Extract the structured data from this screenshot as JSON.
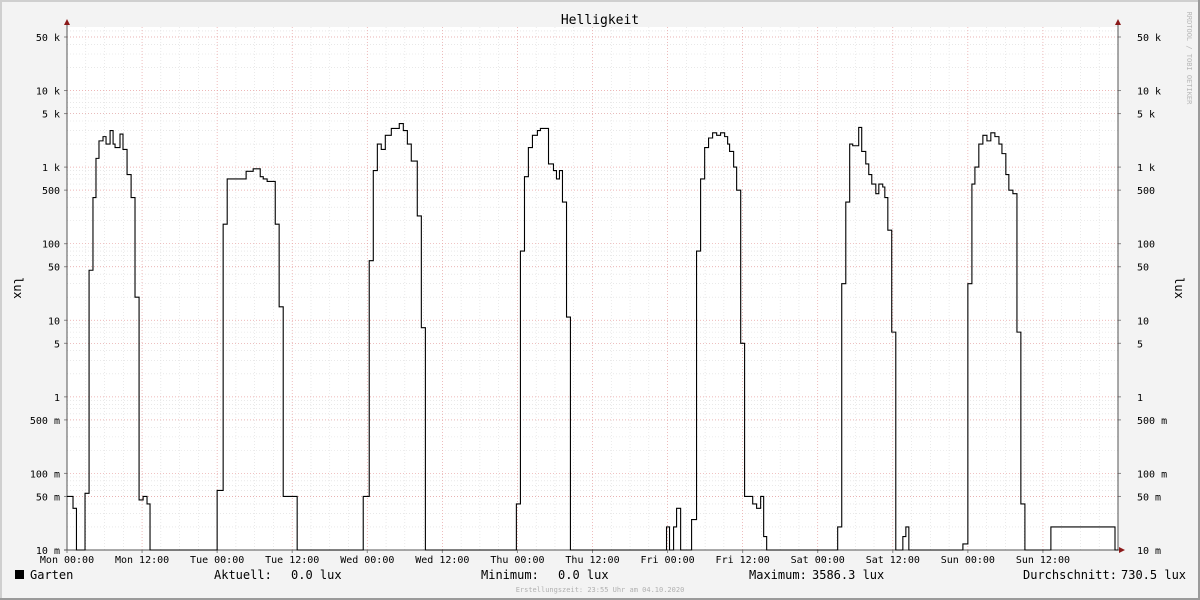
{
  "chart_data": {
    "type": "line",
    "title": "Helligkeit",
    "ylabel": "lux",
    "ylabel_right": "lux",
    "y_scale": "log",
    "ylim": [
      0.01,
      80000
    ],
    "xlim_days": [
      0,
      7
    ],
    "grid": true,
    "y_ticks": [
      {
        "value": 50000,
        "label": "50 k"
      },
      {
        "value": 10000,
        "label": "10 k"
      },
      {
        "value": 5000,
        "label": "5 k"
      },
      {
        "value": 1000,
        "label": "1 k"
      },
      {
        "value": 500,
        "label": "500"
      },
      {
        "value": 100,
        "label": "100"
      },
      {
        "value": 50,
        "label": "50"
      },
      {
        "value": 10,
        "label": "10"
      },
      {
        "value": 5,
        "label": "5"
      },
      {
        "value": 1,
        "label": "1"
      },
      {
        "value": 0.5,
        "label": "500 m"
      },
      {
        "value": 0.1,
        "label": "100 m"
      },
      {
        "value": 0.05,
        "label": "50 m"
      },
      {
        "value": 0.01,
        "label": "10 m"
      }
    ],
    "x_ticks": [
      {
        "value": 0,
        "label": "Mon 00:00"
      },
      {
        "value": 0.5,
        "label": "Mon 12:00"
      },
      {
        "value": 1,
        "label": "Tue 00:00"
      },
      {
        "value": 1.5,
        "label": "Tue 12:00"
      },
      {
        "value": 2,
        "label": "Wed 00:00"
      },
      {
        "value": 2.5,
        "label": "Wed 12:00"
      },
      {
        "value": 3,
        "label": "Thu 00:00"
      },
      {
        "value": 3.5,
        "label": "Thu 12:00"
      },
      {
        "value": 4,
        "label": "Fri 00:00"
      },
      {
        "value": 4.5,
        "label": "Fri 12:00"
      },
      {
        "value": 5,
        "label": "Sat 00:00"
      },
      {
        "value": 5.5,
        "label": "Sat 12:00"
      },
      {
        "value": 6,
        "label": "Sun 00:00"
      },
      {
        "value": 6.5,
        "label": "Sun 12:00"
      }
    ],
    "series": [
      {
        "name": "Garten",
        "color": "#000000",
        "steps": [
          [
            0.0,
            0.05
          ],
          [
            0.04,
            0.035
          ],
          [
            0.063,
            0.01
          ],
          [
            0.12,
            0.055
          ],
          [
            0.147,
            45
          ],
          [
            0.173,
            400
          ],
          [
            0.193,
            1300
          ],
          [
            0.213,
            2200
          ],
          [
            0.24,
            2500
          ],
          [
            0.26,
            2000
          ],
          [
            0.287,
            3000
          ],
          [
            0.307,
            2000
          ],
          [
            0.32,
            1800
          ],
          [
            0.353,
            2700
          ],
          [
            0.373,
            1700
          ],
          [
            0.4,
            800
          ],
          [
            0.427,
            400
          ],
          [
            0.453,
            20
          ],
          [
            0.48,
            0.045
          ],
          [
            0.507,
            0.05
          ],
          [
            0.533,
            0.04
          ],
          [
            0.553,
            0.01
          ],
          [
            0.98,
            0.01
          ],
          [
            1.0,
            0.06
          ],
          [
            1.04,
            180
          ],
          [
            1.067,
            700
          ],
          [
            1.147,
            700
          ],
          [
            1.193,
            880
          ],
          [
            1.24,
            950
          ],
          [
            1.287,
            750
          ],
          [
            1.307,
            700
          ],
          [
            1.333,
            650
          ],
          [
            1.387,
            180
          ],
          [
            1.413,
            15
          ],
          [
            1.44,
            0.05
          ],
          [
            1.533,
            0.01
          ],
          [
            1.947,
            0.01
          ],
          [
            1.973,
            0.05
          ],
          [
            2.013,
            60
          ],
          [
            2.04,
            900
          ],
          [
            2.067,
            2000
          ],
          [
            2.093,
            1700
          ],
          [
            2.12,
            2600
          ],
          [
            2.16,
            3200
          ],
          [
            2.213,
            3700
          ],
          [
            2.24,
            3000
          ],
          [
            2.267,
            2000
          ],
          [
            2.293,
            1200
          ],
          [
            2.333,
            230
          ],
          [
            2.36,
            8
          ],
          [
            2.387,
            0.01
          ],
          [
            2.967,
            0.01
          ],
          [
            2.993,
            0.04
          ],
          [
            3.02,
            80
          ],
          [
            3.047,
            750
          ],
          [
            3.073,
            1800
          ],
          [
            3.1,
            2600
          ],
          [
            3.133,
            3000
          ],
          [
            3.153,
            3200
          ],
          [
            3.207,
            1100
          ],
          [
            3.24,
            900
          ],
          [
            3.26,
            700
          ],
          [
            3.28,
            900
          ],
          [
            3.3,
            350
          ],
          [
            3.327,
            11
          ],
          [
            3.353,
            0.01
          ],
          [
            3.967,
            0.01
          ],
          [
            3.993,
            0.02
          ],
          [
            4.013,
            0.01
          ],
          [
            4.04,
            0.02
          ],
          [
            4.06,
            0.035
          ],
          [
            4.087,
            0.01
          ],
          [
            4.133,
            0.01
          ],
          [
            4.16,
            0.025
          ],
          [
            4.193,
            80
          ],
          [
            4.22,
            700
          ],
          [
            4.247,
            1800
          ],
          [
            4.273,
            2400
          ],
          [
            4.3,
            2800
          ],
          [
            4.327,
            2600
          ],
          [
            4.353,
            2800
          ],
          [
            4.38,
            2500
          ],
          [
            4.4,
            2000
          ],
          [
            4.413,
            1600
          ],
          [
            4.44,
            1000
          ],
          [
            4.46,
            500
          ],
          [
            4.487,
            5
          ],
          [
            4.513,
            0.05
          ],
          [
            4.567,
            0.04
          ],
          [
            4.593,
            0.035
          ],
          [
            4.62,
            0.05
          ],
          [
            4.64,
            0.015
          ],
          [
            4.66,
            0.01
          ],
          [
            5.107,
            0.01
          ],
          [
            5.133,
            0.02
          ],
          [
            5.16,
            30
          ],
          [
            5.187,
            350
          ],
          [
            5.213,
            2000
          ],
          [
            5.233,
            1900
          ],
          [
            5.273,
            3300
          ],
          [
            5.293,
            1600
          ],
          [
            5.32,
            1100
          ],
          [
            5.34,
            800
          ],
          [
            5.36,
            600
          ],
          [
            5.387,
            450
          ],
          [
            5.407,
            600
          ],
          [
            5.433,
            550
          ],
          [
            5.447,
            400
          ],
          [
            5.467,
            150
          ],
          [
            5.493,
            7
          ],
          [
            5.52,
            0.01
          ],
          [
            5.547,
            0.01
          ],
          [
            5.567,
            0.015
          ],
          [
            5.587,
            0.02
          ],
          [
            5.607,
            0.01
          ],
          [
            5.953,
            0.01
          ],
          [
            5.967,
            0.012
          ],
          [
            6.0,
            30
          ],
          [
            6.027,
            600
          ],
          [
            6.047,
            1000
          ],
          [
            6.073,
            2000
          ],
          [
            6.1,
            2600
          ],
          [
            6.127,
            2200
          ],
          [
            6.153,
            2800
          ],
          [
            6.18,
            2500
          ],
          [
            6.207,
            2000
          ],
          [
            6.227,
            1500
          ],
          [
            6.253,
            800
          ],
          [
            6.273,
            500
          ],
          [
            6.3,
            450
          ],
          [
            6.327,
            7
          ],
          [
            6.353,
            0.04
          ],
          [
            6.38,
            0.01
          ],
          [
            6.527,
            0.01
          ],
          [
            6.553,
            0.02
          ],
          [
            6.98,
            0.01
          ],
          [
            7.0,
            0.01
          ]
        ]
      }
    ],
    "legend": {
      "label": "Garten",
      "color": "#000000",
      "position": "bottom-left"
    },
    "stats": [
      {
        "label": "Aktuell:",
        "value": "0.0 lux"
      },
      {
        "label": "Minimum:",
        "value": "0.0 lux"
      },
      {
        "label": "Maximum:",
        "value": "3586.3 lux"
      },
      {
        "label": "Durchschnitt:",
        "value": "730.5 lux"
      }
    ],
    "watermark": "RRDTOOL / TOBI OETIKER",
    "footer": "Erstellungszeit: 23:55 Uhr am 04.10.2020"
  }
}
